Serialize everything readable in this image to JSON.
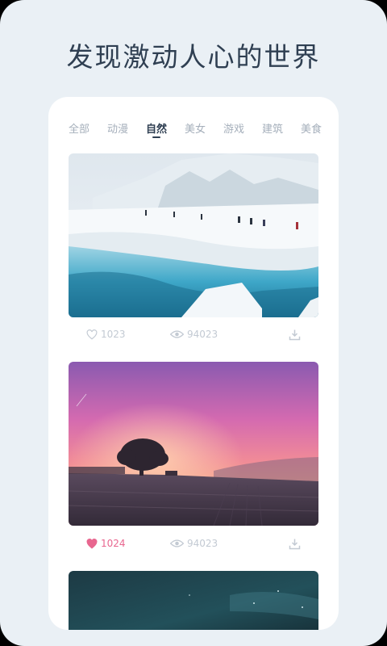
{
  "headline": "发现激动人心的世界",
  "tabs": [
    {
      "label": "全部",
      "active": false
    },
    {
      "label": "动漫",
      "active": false
    },
    {
      "label": "自然",
      "active": true
    },
    {
      "label": "美女",
      "active": false
    },
    {
      "label": "游戏",
      "active": false
    },
    {
      "label": "建筑",
      "active": false
    },
    {
      "label": "美食",
      "active": false
    }
  ],
  "cards": [
    {
      "subject": "snowy glacier with hikers",
      "likes": "1023",
      "liked": false,
      "views": "94023"
    },
    {
      "subject": "tree at pink sunset over field",
      "likes": "1024",
      "liked": true,
      "views": "94023"
    },
    {
      "subject": "dark teal night sky",
      "visible": "partial"
    }
  ],
  "icons": {
    "like": "heart-icon",
    "views": "eye-icon",
    "download": "download-icon"
  },
  "colors": {
    "background": "#eaf0f5",
    "title": "#2f3f52",
    "tab_inactive": "#a5afbb",
    "meta_text": "#c3cad3",
    "liked": "#e8668f"
  }
}
